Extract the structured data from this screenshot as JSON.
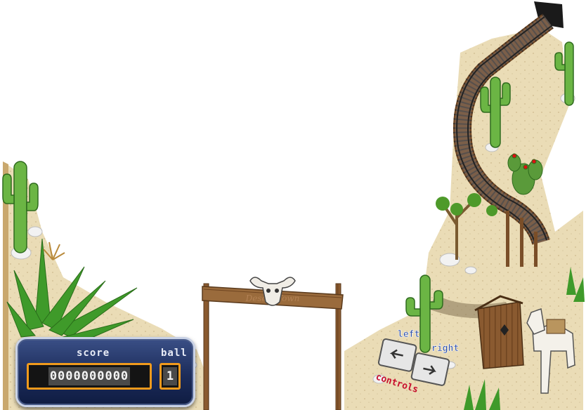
{
  "hud": {
    "score_label": "score",
    "ball_label": "ball",
    "score_value": "0000000000",
    "ball_value": "1"
  },
  "controls": {
    "left_label": "left",
    "right_label": "right",
    "controls_label": "controls"
  },
  "sign": {
    "text": "Desert Town"
  },
  "colors": {
    "sand": "#eadcb6",
    "cactus": "#5fa83a",
    "wood": "#8a5a30",
    "rail": "#4a3a2e",
    "hud_bg": "#1c2c5a",
    "hud_accent": "#f09a1c",
    "controls_text": "#c8102e",
    "label_blue": "#2a4da8"
  }
}
